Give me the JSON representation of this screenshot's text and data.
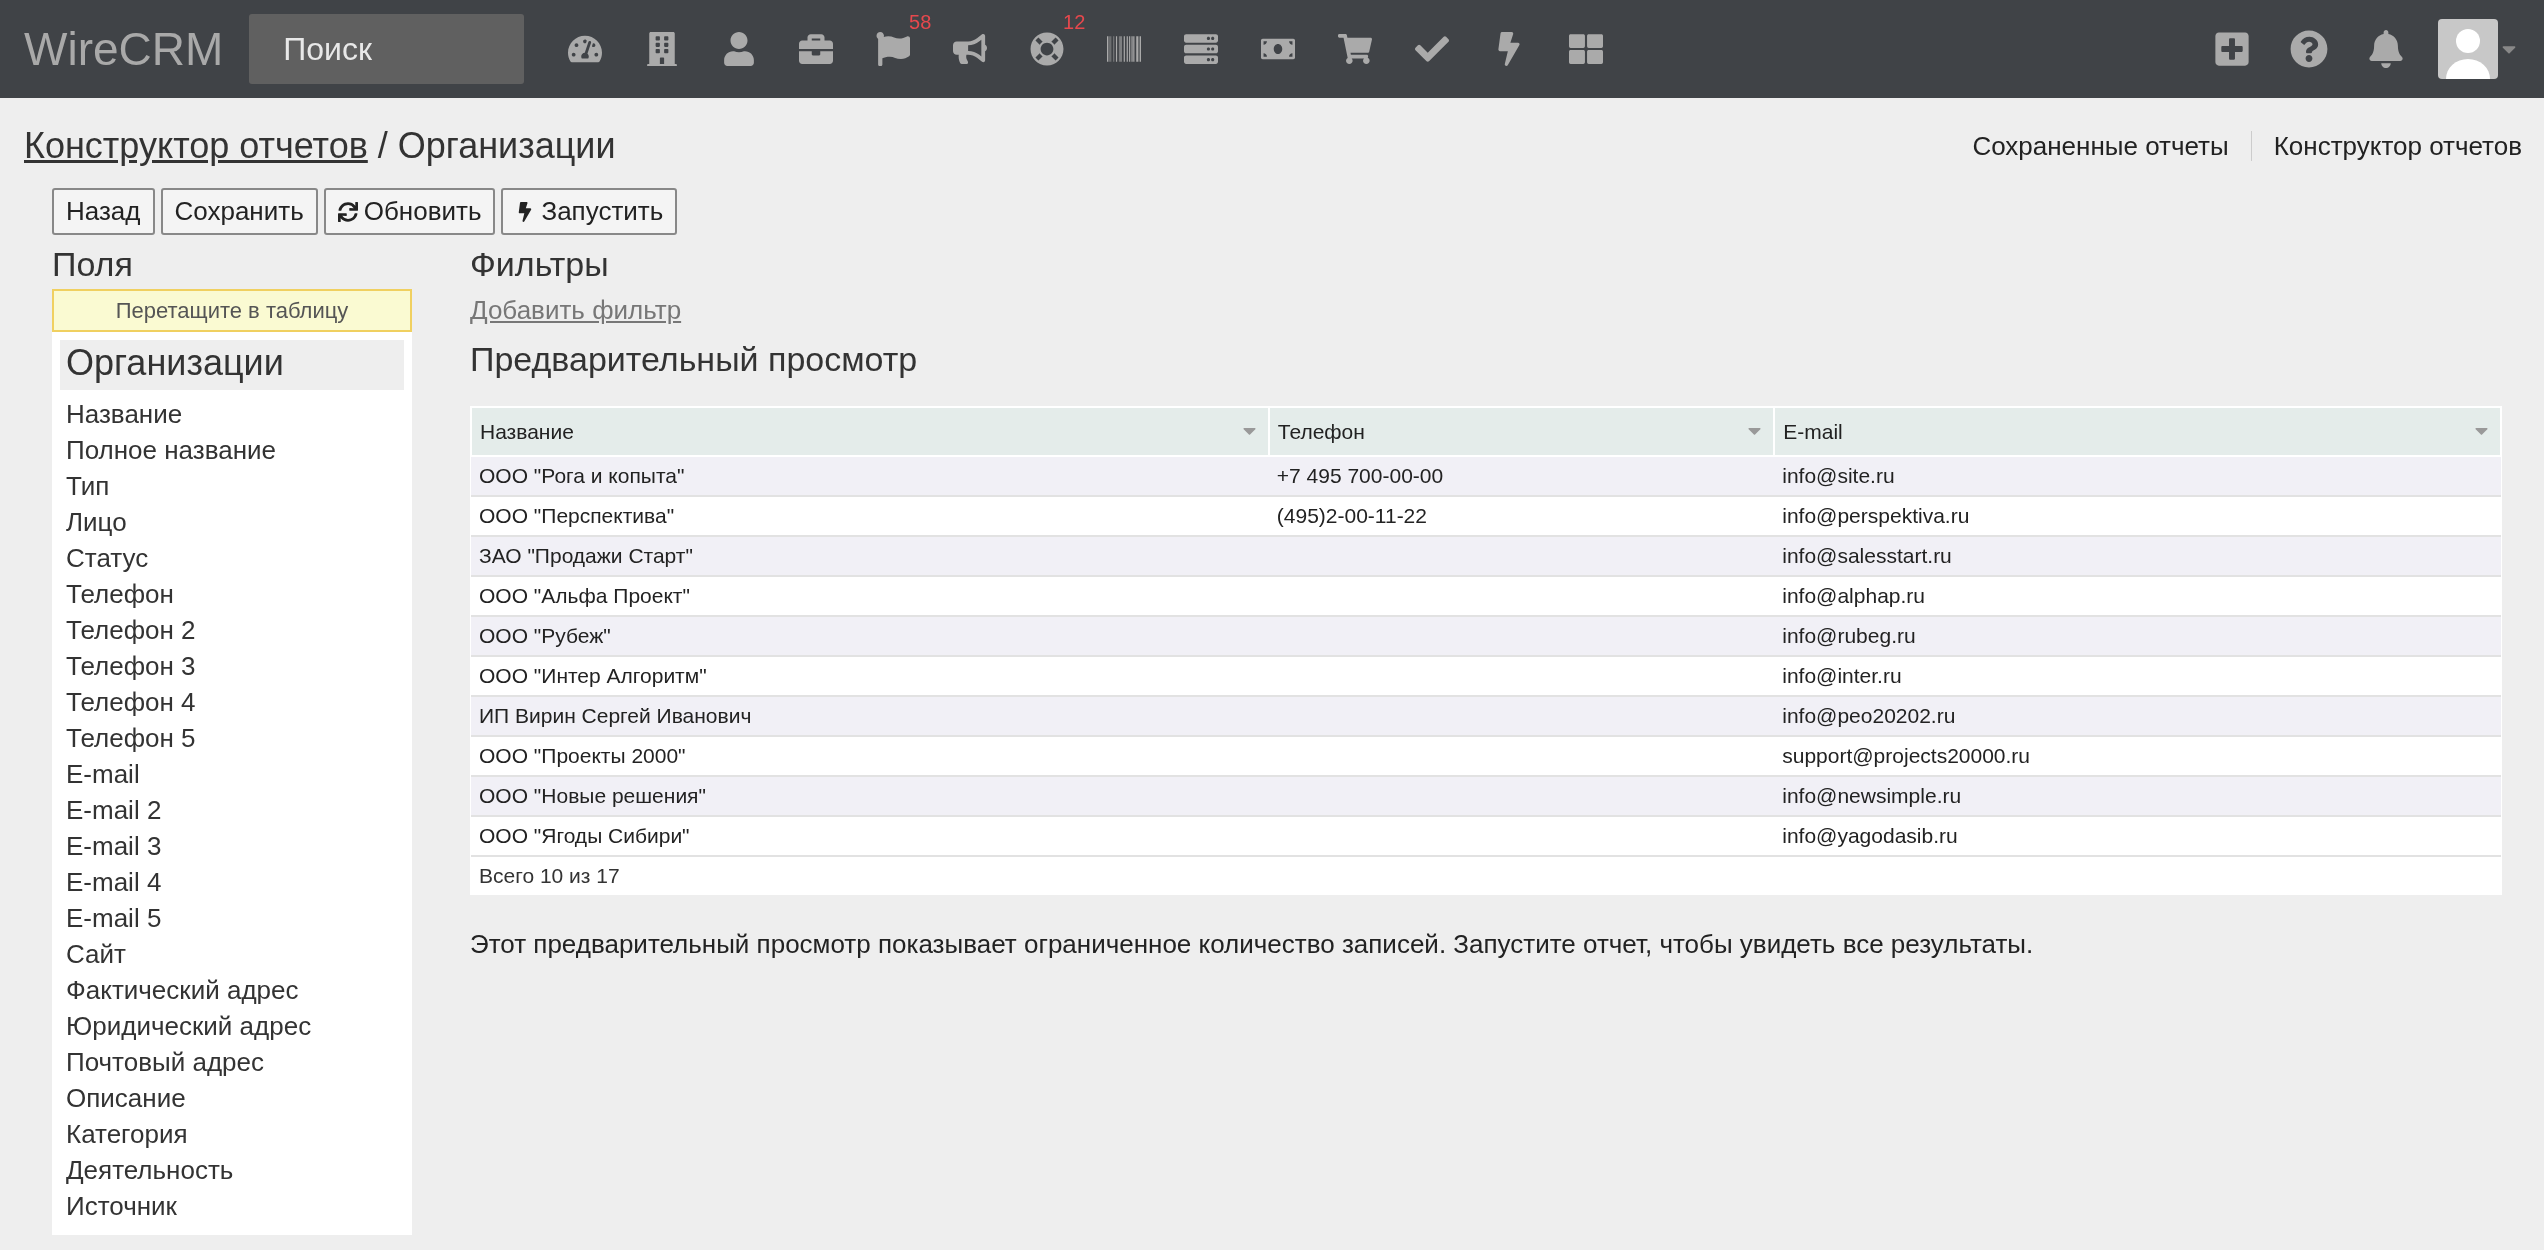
{
  "topbar": {
    "logo": "WireCRM",
    "search": {
      "placeholder": "Поиск"
    },
    "nav_icons": [
      {
        "kind": "dashboard"
      },
      {
        "kind": "building"
      },
      {
        "kind": "person"
      },
      {
        "kind": "briefcase"
      },
      {
        "kind": "flag",
        "badge": "58"
      },
      {
        "kind": "megaphone"
      },
      {
        "kind": "lifebuoy",
        "badge": "12"
      },
      {
        "kind": "barcode"
      },
      {
        "kind": "server"
      },
      {
        "kind": "money"
      },
      {
        "kind": "cart"
      },
      {
        "kind": "check"
      },
      {
        "kind": "bolt"
      },
      {
        "kind": "grid"
      }
    ],
    "right_icons": [
      {
        "kind": "plus"
      },
      {
        "kind": "help"
      },
      {
        "kind": "bell"
      }
    ]
  },
  "breadcrumb": {
    "link": "Конструктор отчетов",
    "separator": "/",
    "current": "Организации"
  },
  "top_links": [
    "Сохраненные отчеты",
    "Конструктор отчетов"
  ],
  "buttons": [
    {
      "label": "Назад"
    },
    {
      "label": "Сохранить"
    },
    {
      "label": "Обновить",
      "kind": "refresh"
    },
    {
      "label": "Запустить",
      "kind": "bolt"
    }
  ],
  "fields": {
    "title": "Поля",
    "hint": "Перетащите в таблицу",
    "group": "Организации",
    "items": [
      "Название",
      "Полное название",
      "Тип",
      "Лицо",
      "Статус",
      "Телефон",
      "Телефон 2",
      "Телефон 3",
      "Телефон 4",
      "Телефон 5",
      "E-mail",
      "E-mail 2",
      "E-mail 3",
      "E-mail 4",
      "E-mail 5",
      "Сайт",
      "Фактический адрес",
      "Юридический адрес",
      "Почтовый адрес",
      "Описание",
      "Категория",
      "Деятельность",
      "Источник"
    ]
  },
  "filters": {
    "title": "Фильтры",
    "add_link": "Добавить фильтр"
  },
  "preview": {
    "title": "Предварительный просмотр",
    "columns": [
      "Название",
      "Телефон",
      "E-mail"
    ],
    "rows": [
      [
        "ООО \"Рога и копыта\"",
        "+7 495 700-00-00",
        "info@site.ru"
      ],
      [
        "ООО \"Перспектива\"",
        "(495)2-00-11-22",
        "info@perspektiva.ru"
      ],
      [
        "ЗАО \"Продажи Старт\"",
        "",
        "info@salesstart.ru"
      ],
      [
        "ООО \"Альфа Проект\"",
        "",
        "info@alphap.ru"
      ],
      [
        "ООО \"Рубеж\"",
        "",
        "info@rubeg.ru"
      ],
      [
        "ООО \"Интер Алгоритм\"",
        "",
        "info@inter.ru"
      ],
      [
        "ИП Вирин Сергей Иванович",
        "",
        "info@peo20202.ru"
      ],
      [
        "ООО \"Проекты 2000\"",
        "",
        "support@projects20000.ru"
      ],
      [
        "ООО \"Новые решения\"",
        "",
        "info@newsimple.ru"
      ],
      [
        "ООО \"Ягоды Сибири\"",
        "",
        "info@yagodasib.ru"
      ]
    ],
    "footer": "Всего 10 из 17",
    "note": "Этот предварительный просмотр показывает ограниченное количество записей. Запустите отчет, чтобы увидеть все результаты."
  }
}
